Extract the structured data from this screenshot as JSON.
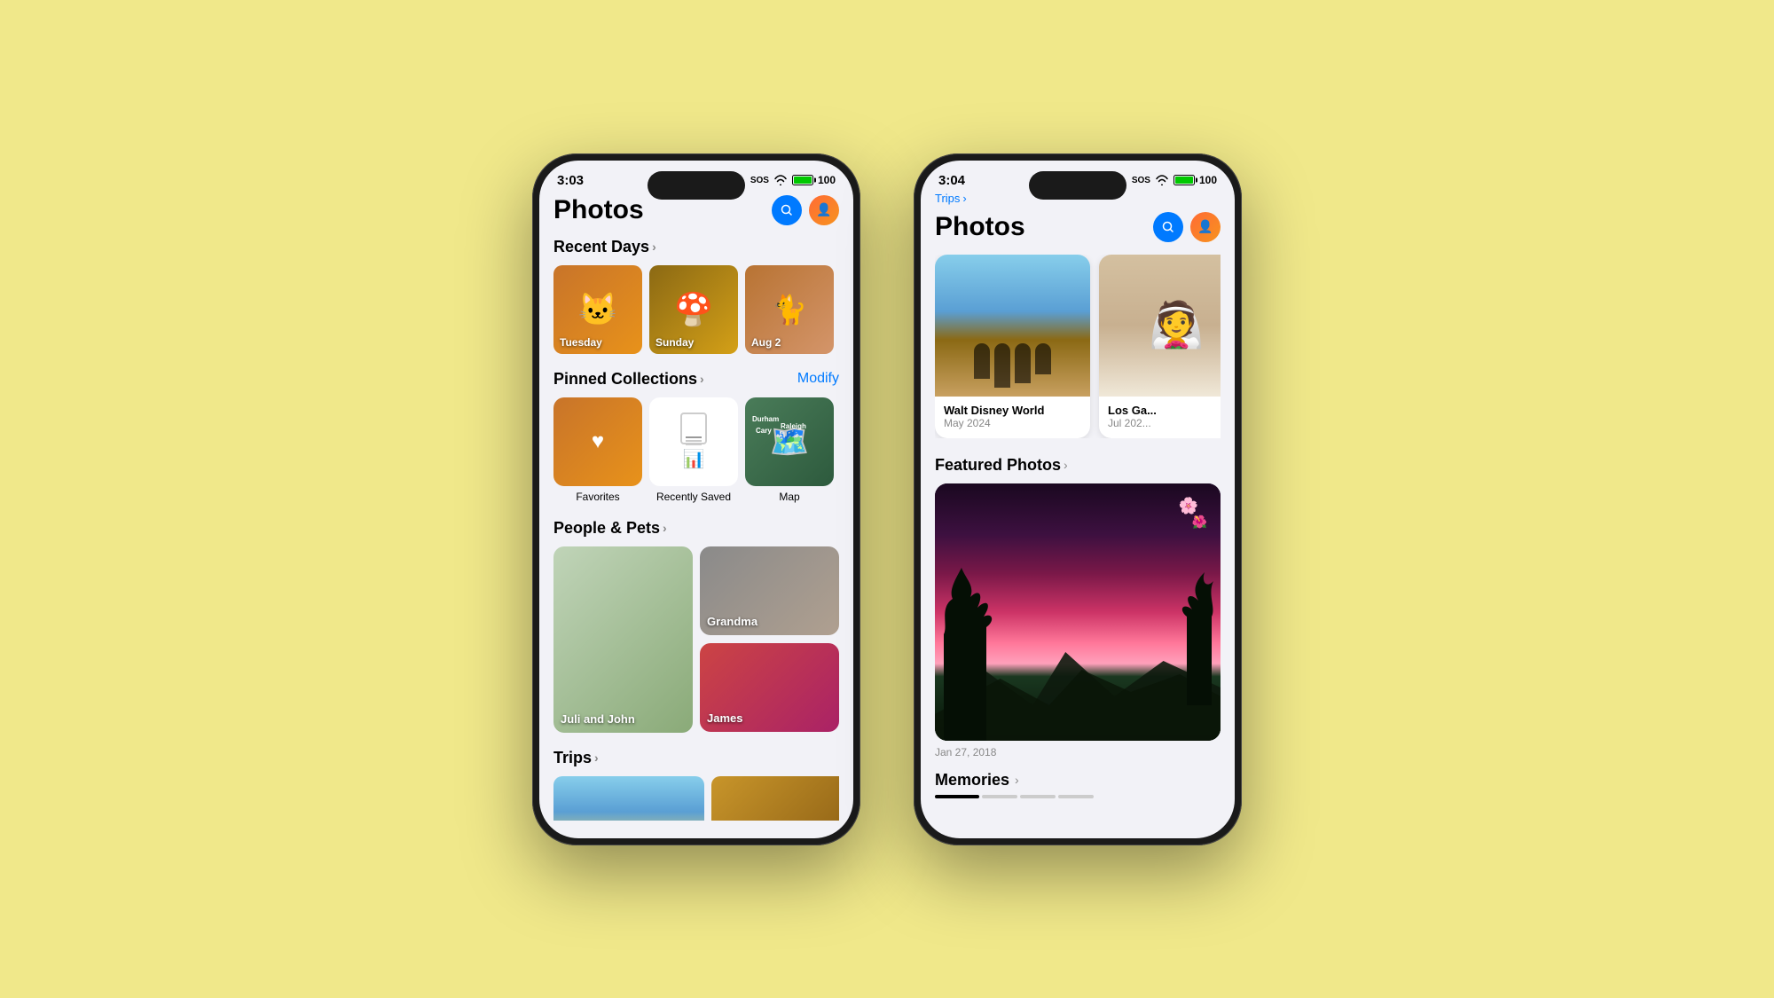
{
  "background": "#f0e88a",
  "phone_left": {
    "status_bar": {
      "time": "3:03",
      "sos": "SOS",
      "battery": "100"
    },
    "header": {
      "title": "Photos",
      "search_label": "Search",
      "avatar_label": "User avatar"
    },
    "recent_days": {
      "section_title": "Recent Days",
      "chevron": "›",
      "items": [
        {
          "label": "Tuesday",
          "emoji": "🐱",
          "color1": "#c8742a",
          "color2": "#e8921a"
        },
        {
          "label": "Sunday",
          "emoji": "🍄",
          "color1": "#8B6914",
          "color2": "#D4A017"
        },
        {
          "label": "Aug 2",
          "emoji": "🐱",
          "color1": "#b87333",
          "color2": "#d4956a"
        }
      ]
    },
    "pinned_collections": {
      "section_title": "Pinned Collections",
      "chevron": "›",
      "modify_label": "Modify",
      "items": [
        {
          "label": "Favorites"
        },
        {
          "label": "Recently Saved"
        },
        {
          "label": "Map"
        }
      ]
    },
    "people_pets": {
      "section_title": "People & Pets",
      "chevron": "›",
      "items": [
        {
          "label": "Juli and John"
        },
        {
          "label": "Grandma"
        },
        {
          "label": "James"
        }
      ]
    },
    "trips": {
      "section_title": "Trips",
      "chevron": "›"
    }
  },
  "phone_right": {
    "status_bar": {
      "time": "3:04",
      "sos": "SOS",
      "battery": "100"
    },
    "breadcrumb": "Trips",
    "breadcrumb_chevron": "›",
    "header": {
      "title": "Photos",
      "search_label": "Search",
      "avatar_label": "User avatar"
    },
    "trips_albums": {
      "items": [
        {
          "title": "Walt Disney World",
          "date": "May 2024"
        },
        {
          "title": "Los Ga...",
          "date": "Jul 202..."
        }
      ]
    },
    "featured_photos": {
      "section_title": "Featured Photos",
      "chevron": "›",
      "date": "Jan 27, 2018"
    },
    "memories": {
      "section_title": "Memories",
      "chevron": "›"
    }
  }
}
